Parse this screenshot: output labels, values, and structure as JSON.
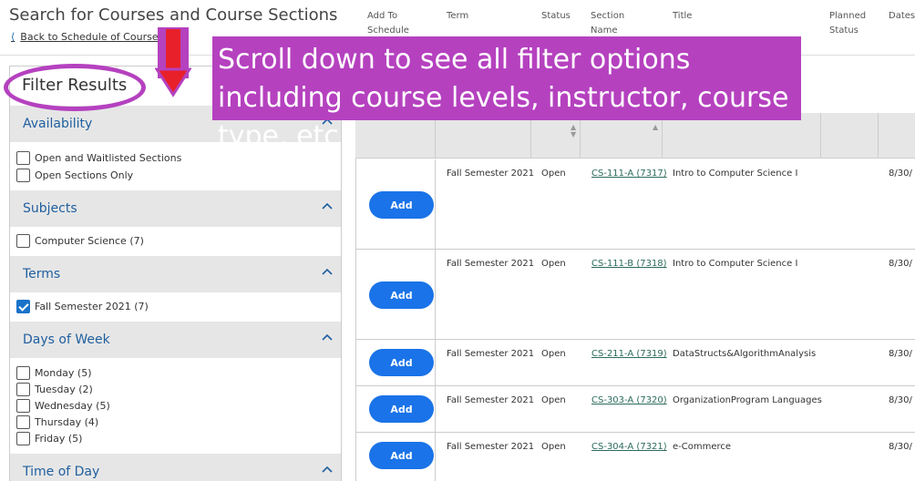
{
  "page": {
    "title": "Search for Courses and Course Sections",
    "back_link": "Back to Schedule of Courses"
  },
  "filter": {
    "heading": "Filter Results",
    "sections": [
      {
        "label": "Availability",
        "options": [
          {
            "label": "Open and Waitlisted Sections",
            "checked": false
          },
          {
            "label": "Open Sections Only",
            "checked": false
          }
        ]
      },
      {
        "label": "Subjects",
        "options": [
          {
            "label": "Computer Science (7)",
            "checked": false
          }
        ]
      },
      {
        "label": "Terms",
        "options": [
          {
            "label": "Fall Semester 2021 (7)",
            "checked": true
          }
        ]
      },
      {
        "label": "Days of Week",
        "options": [
          {
            "label": "Monday (5)",
            "checked": false
          },
          {
            "label": "Tuesday (2)",
            "checked": false
          },
          {
            "label": "Wednesday (5)",
            "checked": false
          },
          {
            "label": "Thursday (4)",
            "checked": false
          },
          {
            "label": "Friday (5)",
            "checked": false
          }
        ]
      },
      {
        "label": "Time of Day",
        "options": []
      }
    ]
  },
  "table": {
    "headers": {
      "add": "Add To Schedule",
      "term": "Term",
      "status": "Status",
      "section": "Section Name",
      "title": "Title",
      "planned": "Planned Status",
      "dates": "Dates"
    },
    "add_label": "Add",
    "rows": [
      {
        "term": "Fall Semester 2021",
        "status": "Open",
        "section": "CS-111-A (7317)",
        "title": "Intro to Computer Science I",
        "dates": "8/30/"
      },
      {
        "term": "Fall Semester 2021",
        "status": "Open",
        "section": "CS-111-B (7318)",
        "title": "Intro to Computer Science I",
        "dates": "8/30/"
      },
      {
        "term": "Fall Semester 2021",
        "status": "Open",
        "section": "CS-211-A (7319)",
        "title": "DataStructs&AlgorithmAnalysis",
        "dates": "8/30/"
      },
      {
        "term": "Fall Semester 2021",
        "status": "Open",
        "section": "CS-303-A (7320)",
        "title": "OrganizationProgram Languages",
        "dates": "8/30/"
      },
      {
        "term": "Fall Semester 2021",
        "status": "Open",
        "section": "CS-304-A (7321)",
        "title": "e-Commerce",
        "dates": "8/30/"
      }
    ]
  },
  "annotation": {
    "callout": "Scroll down to see all filter options including course levels, instructor, course type, etc.",
    "color": "#b541bf",
    "arrow_color": "#e8202a"
  },
  "icons": {
    "back": "chevron-left-icon",
    "collapse": "chevron-up-icon",
    "sort": "sort-icon"
  }
}
